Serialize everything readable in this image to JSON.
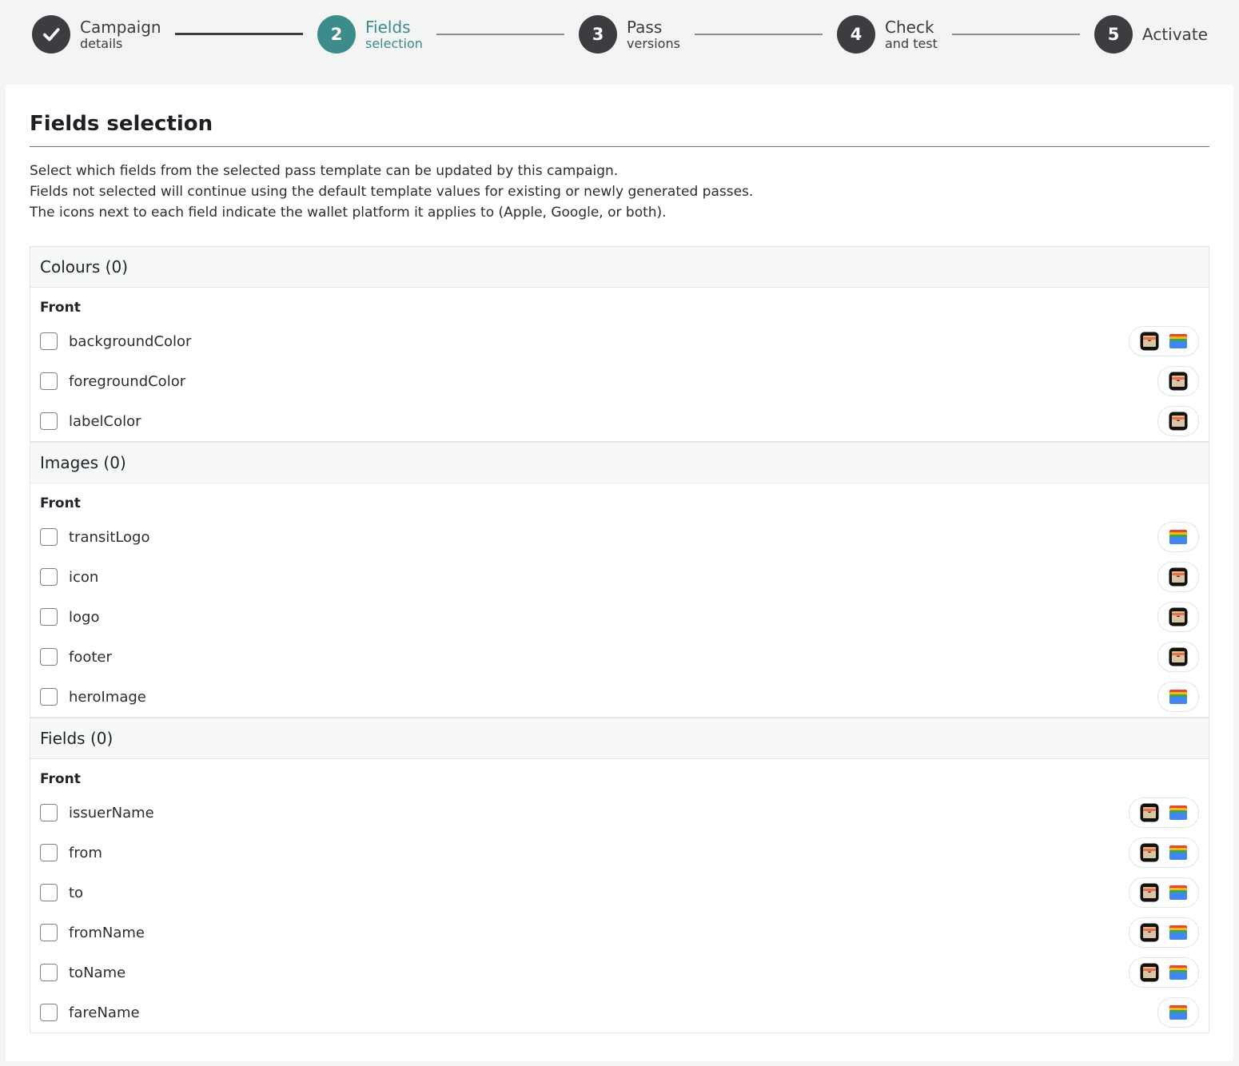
{
  "stepper": {
    "steps": [
      {
        "number": "",
        "title": "Campaign",
        "subtitle": "details",
        "state": "done"
      },
      {
        "number": "2",
        "title": "Fields",
        "subtitle": "selection",
        "state": "active"
      },
      {
        "number": "3",
        "title": "Pass",
        "subtitle": "versions",
        "state": "upcoming"
      },
      {
        "number": "4",
        "title": "Check",
        "subtitle": "and test",
        "state": "upcoming"
      },
      {
        "number": "5",
        "title": "Activate",
        "subtitle": "",
        "state": "upcoming"
      }
    ]
  },
  "main": {
    "title": "Fields selection",
    "intro": [
      "Select which fields from the selected pass template can be updated by this campaign.",
      "Fields not selected will continue using the default template values for existing or newly generated passes.",
      "The icons next to each field indicate the wallet platform it applies to (Apple, Google, or both)."
    ]
  },
  "groups": [
    {
      "title": "Colours (0)",
      "section": "Front",
      "fields": [
        {
          "label": "backgroundColor",
          "platforms": [
            "apple-wallet-icon",
            "google-wallet-icon"
          ],
          "checked": false
        },
        {
          "label": "foregroundColor",
          "platforms": [
            "apple-wallet-icon"
          ],
          "checked": false
        },
        {
          "label": "labelColor",
          "platforms": [
            "apple-wallet-icon"
          ],
          "checked": false
        }
      ]
    },
    {
      "title": "Images (0)",
      "section": "Front",
      "fields": [
        {
          "label": "transitLogo",
          "platforms": [
            "google-wallet-icon"
          ],
          "checked": false
        },
        {
          "label": "icon",
          "platforms": [
            "apple-wallet-icon"
          ],
          "checked": false
        },
        {
          "label": "logo",
          "platforms": [
            "apple-wallet-icon"
          ],
          "checked": false
        },
        {
          "label": "footer",
          "platforms": [
            "apple-wallet-icon"
          ],
          "checked": false
        },
        {
          "label": "heroImage",
          "platforms": [
            "google-wallet-icon"
          ],
          "checked": false
        }
      ]
    },
    {
      "title": "Fields (0)",
      "section": "Front",
      "fields": [
        {
          "label": "issuerName",
          "platforms": [
            "apple-wallet-icon",
            "google-wallet-icon"
          ],
          "checked": false
        },
        {
          "label": "from",
          "platforms": [
            "apple-wallet-icon",
            "google-wallet-icon"
          ],
          "checked": false
        },
        {
          "label": "to",
          "platforms": [
            "apple-wallet-icon",
            "google-wallet-icon"
          ],
          "checked": false
        },
        {
          "label": "fromName",
          "platforms": [
            "apple-wallet-icon",
            "google-wallet-icon"
          ],
          "checked": false
        },
        {
          "label": "toName",
          "platforms": [
            "apple-wallet-icon",
            "google-wallet-icon"
          ],
          "checked": false
        },
        {
          "label": "fareName",
          "platforms": [
            "google-wallet-icon"
          ],
          "checked": false
        }
      ]
    }
  ],
  "colors": {
    "accent": "#3b8c8a",
    "step_dark": "#3b3d40"
  }
}
